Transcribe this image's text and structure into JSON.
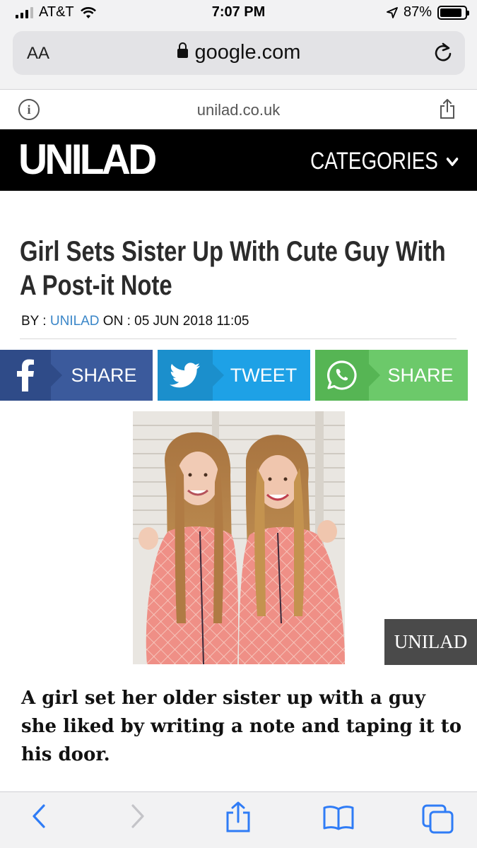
{
  "status": {
    "carrier": "AT&T",
    "time": "7:07 PM",
    "battery": "87%",
    "battery_level": 0.87
  },
  "browser": {
    "text_size_label": "AA",
    "url": "google.com",
    "site_domain": "unilad.co.uk"
  },
  "header": {
    "logo": "UNILAD",
    "categories_label": "CATEGORIES"
  },
  "article": {
    "title": "Girl Sets Sister Up With Cute Guy With A Post-it Note",
    "by_label": "BY : ",
    "author": "UNILAD",
    "date_label": " ON : 05 JUN 2018 11:05",
    "body": "A girl set her older sister up with a guy she liked by writing a note and taping it to his door.",
    "watermark": "UNILAD"
  },
  "share": {
    "facebook_label": "SHARE",
    "twitter_label": "TWEET",
    "whatsapp_label": "SHARE"
  },
  "colors": {
    "facebook": "#3b5a9c",
    "twitter": "#1ea1e6",
    "whatsapp": "#6cc96a",
    "accent_link": "#3a86c8",
    "ios_blue": "#2f7cf6"
  }
}
